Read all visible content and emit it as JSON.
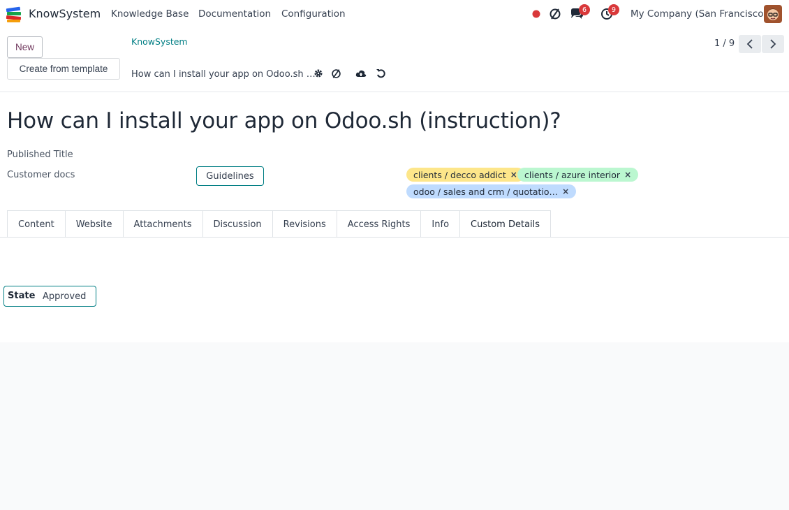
{
  "app": {
    "name": "KnowSystem",
    "logo_icon": "books-stack-icon"
  },
  "nav": {
    "menu": [
      "Knowledge Base",
      "Documentation",
      "Configuration"
    ],
    "company": "My Company (San Francisco)",
    "messages_count": "6",
    "activities_count": "9",
    "colors": {
      "status_dot": "#d9383a",
      "badge": "#d9383a"
    }
  },
  "control_panel": {
    "new_label": "New",
    "template_label": "Create from template",
    "breadcrumb": "KnowSystem",
    "record_title": "How can I install your app on Odoo.sh …",
    "pager": "1 / 9"
  },
  "form": {
    "title": "How can I install your app on Odoo.sh (instruction)?",
    "published_title_label": "Published Title",
    "section_label": "Customer docs",
    "type_value": "Guidelines",
    "tags": [
      {
        "label": "clients / decco addict",
        "color": "#fde68a"
      },
      {
        "label": "clients / azure interior",
        "color": "#bbf7d0"
      },
      {
        "label": "odoo / sales and crm / quotatio…",
        "color": "#bfdbfe"
      }
    ],
    "tag_remove_glyph": "×"
  },
  "tabs": [
    "Content",
    "Website",
    "Attachments",
    "Discussion",
    "Revisions",
    "Access Rights",
    "Info",
    "Custom Details"
  ],
  "active_tab": "Custom Details",
  "custom_details": {
    "state_label": "State",
    "state_value": "Approved"
  },
  "accent_color": "#017e84",
  "brand_color": "#71395e"
}
